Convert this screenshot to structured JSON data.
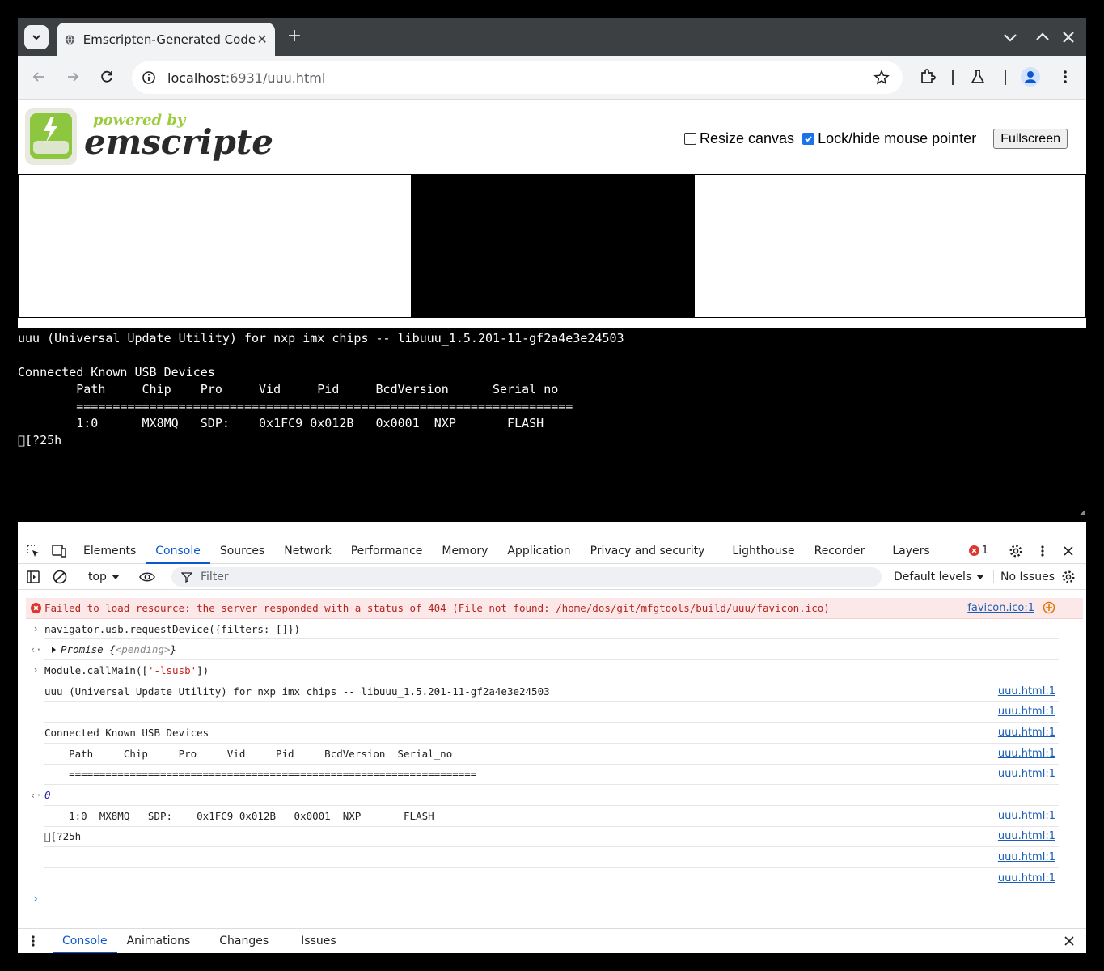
{
  "browser": {
    "tab_title": "Emscripten-Generated Code",
    "url_host": "localhost",
    "url_path": ":6931/uuu.html"
  },
  "page": {
    "logo_text_small": "powered by",
    "logo_text_big": "emscripten",
    "resize_canvas_label": "Resize canvas",
    "lock_mouse_label": "Lock/hide mouse pointer",
    "fullscreen_label": "Fullscreen",
    "output_lines": [
      "uuu (Universal Update Utility) for nxp imx chips -- libuuu_1.5.201-11-gf2a4e3e24503",
      "",
      "Connected Known USB Devices",
      "        Path     Chip    Pro     Vid     Pid     BcdVersion      Serial_no",
      "        ====================================================================",
      "        1:0      MX8MQ   SDP:    0x1FC9 0x012B   0x0001  NXP       FLASH",
      "\u0000[?25h"
    ]
  },
  "devtools": {
    "tabs": [
      "Elements",
      "Console",
      "Sources",
      "Network",
      "Performance",
      "Memory",
      "Application",
      "Privacy and security",
      "Lighthouse",
      "Recorder",
      "Layers"
    ],
    "error_count": "1",
    "context": "top",
    "filter_placeholder": "Filter",
    "levels": "Default levels",
    "issues": "No Issues",
    "console": {
      "error_text": "Failed to load resource: the server responded with a status of 404 (File not found: /home/dos/git/mfgtools/build/uuu/favicon.ico)",
      "error_src": "favicon.ico:1",
      "cmd1": "navigator.usb.requestDevice({filters: []})",
      "promise_label": "Promise",
      "promise_state": "<pending>",
      "cmd2_pre": "Module.callMain([",
      "cmd2_str": "'-lsusb'",
      "cmd2_post": "])",
      "log1": "uuu (Universal Update Utility) for nxp imx chips -- libuuu_1.5.201-11-gf2a4e3e24503",
      "log3": "Connected Known USB Devices",
      "log4": "    Path     Chip     Pro     Vid     Pid     BcdVersion  Serial_no",
      "log5": "    ===================================================================",
      "return_val": "0",
      "log6": "    1:0  MX8MQ   SDP:    0x1FC9 0x012B   0x0001  NXP       FLASH",
      "log7": "\u0000[?25h",
      "src": "uuu.html:1"
    },
    "drawer_tabs": [
      "Console",
      "Animations",
      "Changes",
      "Issues"
    ]
  }
}
